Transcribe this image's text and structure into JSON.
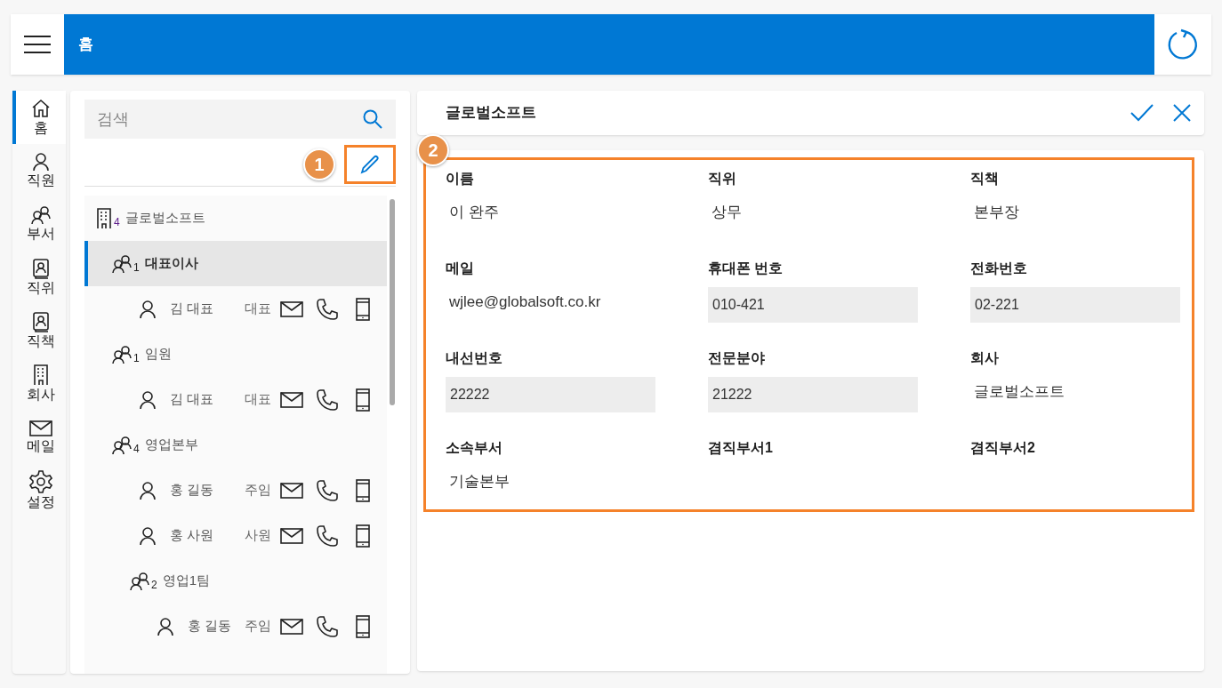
{
  "header": {
    "title": "홈"
  },
  "nav": [
    {
      "kind": "home",
      "label": "홈",
      "selected": true
    },
    {
      "kind": "person",
      "label": "직원",
      "selected": false
    },
    {
      "kind": "group",
      "label": "부서",
      "selected": false
    },
    {
      "kind": "badge",
      "label": "직위",
      "selected": false
    },
    {
      "kind": "badge",
      "label": "직책",
      "selected": false
    },
    {
      "kind": "building",
      "label": "회사",
      "selected": false
    },
    {
      "kind": "mail",
      "label": "메일",
      "selected": false
    },
    {
      "kind": "gear",
      "label": "설정",
      "selected": false
    }
  ],
  "search": {
    "placeholder": "검색"
  },
  "callouts": [
    "1",
    "2"
  ],
  "tree": [
    {
      "kind": "company",
      "label": "글로벌소프트",
      "count": "4",
      "selected": false,
      "children": [
        {
          "kind": "department",
          "label": "대표이사",
          "count": "1",
          "selected": true,
          "children": [
            {
              "kind": "person",
              "label": "김 대표",
              "title": "대표",
              "selected": false
            }
          ]
        },
        {
          "kind": "department",
          "label": "임원",
          "count": "1",
          "selected": false,
          "children": [
            {
              "kind": "person",
              "label": "김 대표",
              "title": "대표",
              "selected": false
            }
          ]
        },
        {
          "kind": "department",
          "label": "영업본부",
          "count": "4",
          "selected": false,
          "children": [
            {
              "kind": "person",
              "label": "홍 길동",
              "title": "주임",
              "selected": false
            },
            {
              "kind": "person",
              "label": "홍 사원",
              "title": "사원",
              "selected": false
            },
            {
              "kind": "department",
              "label": "영업1팀",
              "count": "2",
              "selected": false,
              "children": [
                {
                  "kind": "person",
                  "label": "홍 길동",
                  "title": "주임",
                  "selected": false
                }
              ]
            }
          ]
        }
      ]
    }
  ],
  "detail": {
    "title": "글로벌소프트",
    "fields": [
      {
        "label": "이름",
        "kind": "text",
        "value": "이 완주"
      },
      {
        "label": "직위",
        "kind": "text",
        "value": "상무"
      },
      {
        "label": "직책",
        "kind": "text",
        "value": "본부장"
      },
      {
        "label": "메일",
        "kind": "text",
        "value": "wjlee@globalsoft.co.kr"
      },
      {
        "label": "휴대폰 번호",
        "kind": "input",
        "value": "010-421"
      },
      {
        "label": "전화번호",
        "kind": "input",
        "value": "02-221"
      },
      {
        "label": "내선번호",
        "kind": "input",
        "value": "22222"
      },
      {
        "label": "전문분야",
        "kind": "input",
        "value": "21222"
      },
      {
        "label": "회사",
        "kind": "text",
        "value": "글로벌소프트"
      },
      {
        "label": "소속부서",
        "kind": "text",
        "value": "기술본부"
      },
      {
        "label": "겸직부서1",
        "kind": "text"
      },
      {
        "label": "겸직부서2",
        "kind": "text"
      }
    ]
  }
}
